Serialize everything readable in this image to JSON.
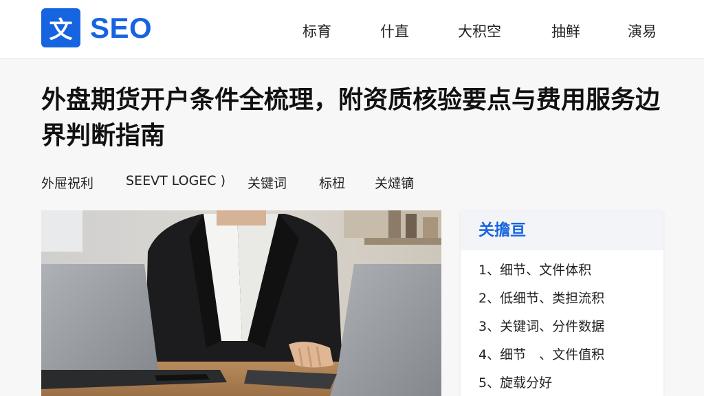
{
  "logo": {
    "glyph": "文",
    "text": "SEO"
  },
  "nav": {
    "items": [
      "标育",
      "什直",
      "大积空",
      "抽鲜",
      "演易"
    ]
  },
  "article": {
    "title": "外盘期货开户条件全梳理，附资质核验要点与费用服务边界判断指南",
    "tags": [
      "外屉祝利",
      "SEEVT LOGEC )",
      "关键词",
      "标杻",
      "关燵镝"
    ]
  },
  "sidebar": {
    "heading": "关擔亘",
    "items": [
      "1、细节、文件体积",
      "2、低细节、类担流积",
      "3、关键词、分件数据",
      "4、细节　、文件值积",
      "5、旋载分好"
    ]
  },
  "colors": {
    "brand": "#1664e0",
    "header_bg": "#ffffff",
    "page_bg": "#f7f7f8",
    "sidebar_head_bg": "#f2f4f7"
  },
  "hero_image": {
    "subject": "person-in-black-suit-typing-on-laptop"
  }
}
